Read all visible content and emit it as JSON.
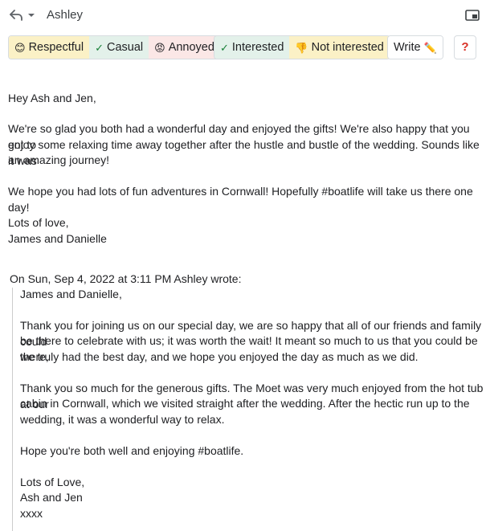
{
  "header": {
    "recipient": "Ashley"
  },
  "chips": {
    "respectful": {
      "emoji": "😊",
      "label": "Respectful"
    },
    "casual": {
      "emoji": "✓",
      "label": "Casual"
    },
    "annoyed": {
      "emoji": "😡",
      "label": "Annoyed"
    },
    "interested": {
      "emoji": "✓",
      "label": "Interested"
    },
    "not_interested": {
      "emoji": "👎",
      "label": "Not interested"
    },
    "write": {
      "label": "Write",
      "emoji": "✏️"
    },
    "help": "?"
  },
  "draft": {
    "greeting": "Hey Ash and Jen,",
    "p1_l1": "We're so glad you both had a wonderful day and enjoyed the gifts! We're also happy that you got to",
    "p1_l2": "enjoy some relaxing time away together after the hustle and bustle of the wedding. Sounds like it was",
    "p1_l3": "an amazing journey!",
    "p2": "We hope you had lots of fun adventures in Cornwall! Hopefully #boatlife will take us there one day!",
    "signoff": "Lots of love,",
    "signature": "James and Danielle"
  },
  "quoted": {
    "header": "On Sun, Sep 4, 2022 at 3:11 PM Ashley wrote:",
    "greeting": "James and Danielle,",
    "p1_l1": "Thank you for joining us on our special day, we are so happy that all of our friends and family could",
    "p1_l2": "be there to celebrate with us; it was worth the wait! It meant so much to us that you could be there,",
    "p1_l3": "we truly had the best day, and we hope you enjoyed the day as much as we did.",
    "p2_l1": "Thank you so much for the generous gifts. The Moet was very much enjoyed from the hot tub at our",
    "p2_l2": "cabin in Cornwall, which we visited straight after the wedding. After the hectic run up to the",
    "p2_l3": "wedding, it was a wonderful way to relax.",
    "p3": "Hope you're both well and enjoying #boatlife.",
    "signoff": "Lots of Love,",
    "signature": "Ash and Jen",
    "kisses": "xxxx"
  }
}
